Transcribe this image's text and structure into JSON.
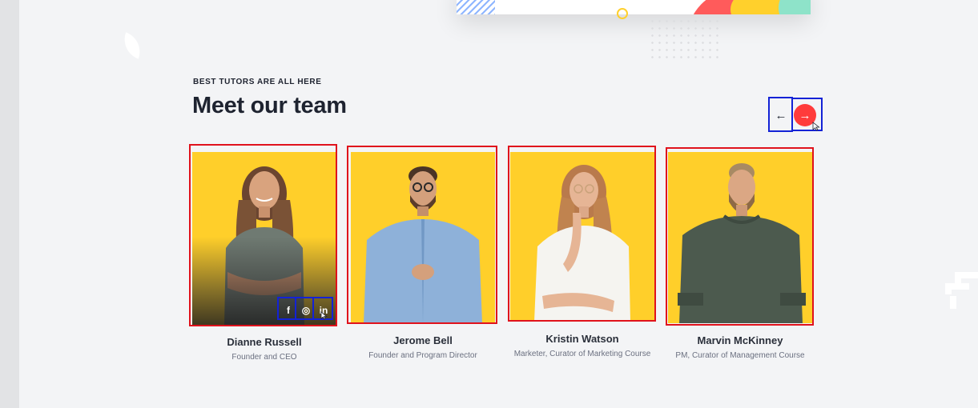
{
  "section": {
    "eyebrow": "BEST TUTORS ARE ALL HERE",
    "title": "Meet our team"
  },
  "nav": {
    "prev_icon": "arrow-left-icon",
    "next_icon": "arrow-right-icon",
    "prev_glyph": "←",
    "next_glyph": "→"
  },
  "colors": {
    "accent": "#ff3b3b",
    "card_bg": "#ffcf2a",
    "highlight_red": "#e0121c",
    "highlight_blue": "#1322d6"
  },
  "team": [
    {
      "name": "Dianne Russell",
      "role": "Founder and CEO",
      "socials": [
        {
          "icon": "facebook-icon",
          "glyph": "f"
        },
        {
          "icon": "instagram-icon",
          "glyph": "◎"
        },
        {
          "icon": "linkedin-icon",
          "glyph": "in"
        }
      ]
    },
    {
      "name": "Jerome Bell",
      "role": "Founder and Program Director"
    },
    {
      "name": "Kristin Watson",
      "role": "Marketer, Curator of Marketing Course"
    },
    {
      "name": "Marvin McKinney",
      "role": "PM, Curator of Management Course"
    }
  ]
}
